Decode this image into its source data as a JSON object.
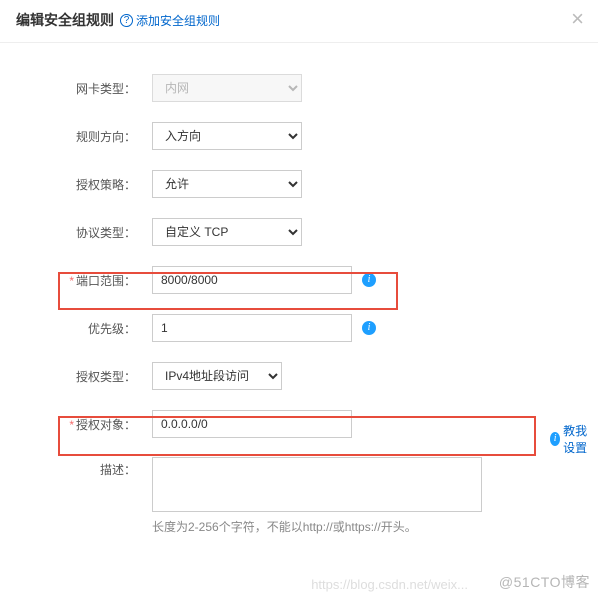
{
  "header": {
    "title": "编辑安全组规则",
    "help_link": "添加安全组规则",
    "close": "×"
  },
  "form": {
    "nic_type": {
      "label": "网卡类型：",
      "value": "内网"
    },
    "direction": {
      "label": "规则方向：",
      "value": "入方向"
    },
    "policy": {
      "label": "授权策略：",
      "value": "允许"
    },
    "protocol": {
      "label": "协议类型：",
      "value": "自定义 TCP"
    },
    "port": {
      "label": "端口范围：",
      "value": "8000/8000"
    },
    "priority": {
      "label": "优先级：",
      "value": "1"
    },
    "auth_type": {
      "label": "授权类型：",
      "value": "IPv4地址段访问"
    },
    "auth_obj": {
      "label": "授权对象：",
      "value": "0.0.0.0/0",
      "teach": "教我设置"
    },
    "desc": {
      "label": "描述：",
      "hint": "长度为2-256个字符，不能以http://或https://开头。"
    }
  },
  "watermark": "@51CTO博客",
  "watermark2": "https://blog.csdn.net/weix..."
}
